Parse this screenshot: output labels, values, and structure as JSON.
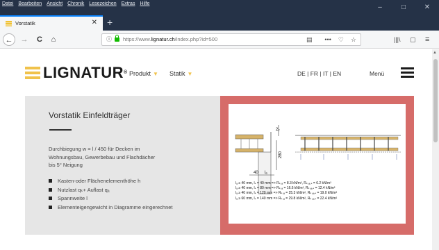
{
  "browser": {
    "menu": [
      "Datei",
      "Bearbeiten",
      "Ansicht",
      "Chronik",
      "Lesezeichen",
      "Extras",
      "Hilfe"
    ],
    "window_controls": [
      "–",
      "□",
      "✕"
    ],
    "tab": {
      "title": "Vorstatik",
      "close": "✕"
    },
    "new_tab": "+",
    "nav": {
      "back": "←",
      "forward": "→",
      "reload": "C",
      "home": "⌂"
    },
    "url": {
      "prefix": "https://www.",
      "domain": "lignatur.ch",
      "path": "/index.php?id=500"
    },
    "url_tools": [
      "•••",
      "♡",
      "☆"
    ],
    "reader_icon": "▤",
    "toolbar_right": [
      "|||\\",
      "▢",
      "≡"
    ],
    "scroll_up": "▲"
  },
  "site": {
    "logo": "LIGNATUR",
    "logo_reg": "®",
    "menu": {
      "produkt": "Produkt",
      "statik": "Statik",
      "triangle": "▼"
    },
    "languages": "DE | FR | IT | EN",
    "menu_label": "Menü"
  },
  "card": {
    "title": "Vorstatik Einfeldträger",
    "description": "Durchbiegung w = l / 450 für Decken im Wohnungsbau, Gewerbebau und Flachdächer bis 5° Neigung",
    "bullets": [
      "Kasten-oder Flächenelementhöhe h",
      "Nutzlast qₖ+ Auflast qₐ",
      "Spannweite l",
      "Elementeigengewicht in Diagramme eingerechnet"
    ],
    "diagram": {
      "dim_top": "2₂",
      "dim_height": "280",
      "dim_width": "40",
      "dim_support": "lₐ",
      "formulas": [
        "lₐ ≥ 40 mm, lₛ = 40 mm => Rₖ,ₐ = 8.3 kN/m², Rₖ,ₐ,ₛ = 6.2 kN/m²",
        "lₐ ≥ 40 mm, lₛ = 80 mm => Rₖ,ₐ = 16.6 kN/m², Rₖ,ₐ,ₛ = 12.4 kN/m²",
        "lₐ ≥ 40 mm, lₛ = 120 mm => Rₖ,ₐ = 25.3 kN/m², Rₖ,ₐ,ₛ = 19.0 kN/m²",
        "lₐ ≥ 60 mm, lₛ = 140 mm => Rₖ,ₐ = 29.8 kN/m², Rₖ,ₐ,ₛ = 22.4 kN/m²"
      ]
    }
  },
  "colors": {
    "chrome_dark": "#253247",
    "accent_yellow": "#f0c24b",
    "card_bg": "#e6e6e6",
    "diagram_frame": "#d66c69",
    "tab_highlight": "#0a84ff",
    "lock_green": "#12bc00"
  }
}
